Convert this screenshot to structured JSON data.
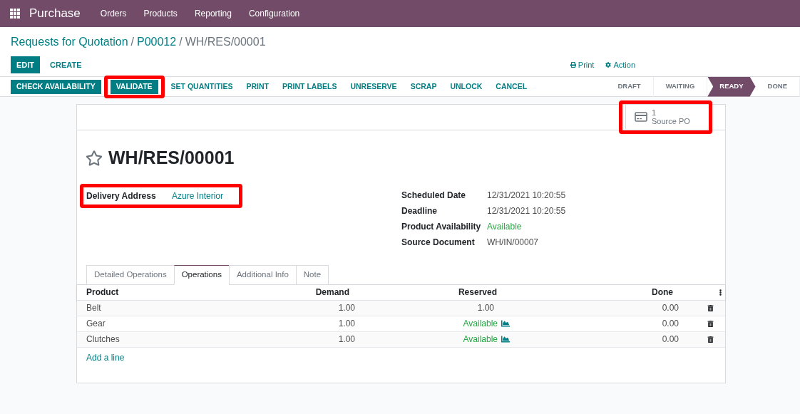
{
  "navbar": {
    "app": "Purchase",
    "menu": [
      "Orders",
      "Products",
      "Reporting",
      "Configuration"
    ]
  },
  "breadcrumb": [
    {
      "label": "Requests for Quotation",
      "kind": "link"
    },
    {
      "label": "/",
      "kind": "separator"
    },
    {
      "label": "P00012",
      "kind": "link"
    },
    {
      "label": "/",
      "kind": "separator"
    },
    {
      "label": "WH/RES/00001",
      "kind": "current"
    }
  ],
  "control_buttons": [
    {
      "label": "EDIT",
      "primary": true
    },
    {
      "label": "CREATE",
      "primary": false
    }
  ],
  "sidebar_actions": [
    {
      "label": "Print",
      "kind": "print"
    },
    {
      "label": "Action",
      "kind": "action"
    }
  ],
  "action_buttons": [
    {
      "label": "CHECK AVAILABILITY",
      "primary": true,
      "highlighted": false
    },
    {
      "label": "VALIDATE",
      "primary": true,
      "highlighted": true
    },
    {
      "label": "SET QUANTITIES",
      "primary": false,
      "highlighted": false
    },
    {
      "label": "PRINT",
      "primary": false,
      "highlighted": false
    },
    {
      "label": "PRINT LABELS",
      "primary": false,
      "highlighted": false
    },
    {
      "label": "UNRESERVE",
      "primary": false,
      "highlighted": false
    },
    {
      "label": "SCRAP",
      "primary": false,
      "highlighted": false
    },
    {
      "label": "UNLOCK",
      "primary": false,
      "highlighted": false
    },
    {
      "label": "CANCEL",
      "primary": false,
      "highlighted": false
    }
  ],
  "status_steps": [
    {
      "label": "DRAFT",
      "selected": false
    },
    {
      "label": "WAITING",
      "selected": false
    },
    {
      "label": "READY",
      "selected": true
    },
    {
      "label": "DONE",
      "selected": false
    }
  ],
  "stat_button": {
    "count": "1",
    "label": "Source PO",
    "highlighted": true
  },
  "record": {
    "title": "WH/RES/00001",
    "starred": false
  },
  "left_fields": [
    {
      "label": "Delivery Address",
      "value": "Azure Interior",
      "kind": "link",
      "highlighted": true
    }
  ],
  "right_fields": [
    {
      "label": "Scheduled Date",
      "value": "12/31/2021 10:20:55",
      "kind": "plain",
      "highlighted": false
    },
    {
      "label": "Deadline",
      "value": "12/31/2021 10:20:55",
      "kind": "plain",
      "highlighted": false
    },
    {
      "label": "Product Availability",
      "value": "Available",
      "kind": "status",
      "highlighted": false
    },
    {
      "label": "Source Document",
      "value": "WH/IN/00007",
      "kind": "plain",
      "highlighted": false
    }
  ],
  "tabs": [
    {
      "label": "Detailed Operations",
      "selected": false
    },
    {
      "label": "Operations",
      "selected": true
    },
    {
      "label": "Additional Info",
      "selected": false
    },
    {
      "label": "Note",
      "selected": false
    }
  ],
  "table": {
    "columns": [
      "Product",
      "Demand",
      "Reserved",
      "Done"
    ],
    "rows": [
      {
        "product": "Belt",
        "demand": "1.00",
        "reserved": {
          "text": "1.00",
          "kind": "quantity"
        },
        "done": "0.00"
      },
      {
        "product": "Gear",
        "demand": "1.00",
        "reserved": {
          "text": "Available",
          "kind": "status"
        },
        "done": "0.00"
      },
      {
        "product": "Clutches",
        "demand": "1.00",
        "reserved": {
          "text": "Available",
          "kind": "status"
        },
        "done": "0.00"
      }
    ],
    "add_line": "Add a line"
  }
}
